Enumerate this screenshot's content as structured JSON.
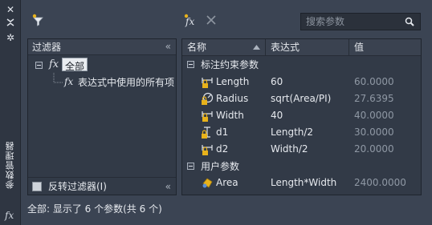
{
  "strip": {
    "title": "参数管理器",
    "fx_label": "fx"
  },
  "toolbar": {
    "filter_icon": "funnel-star-icon",
    "new_param_icon": "fx-star-icon",
    "delete_icon": "close-icon",
    "search_placeholder": "搜索参数"
  },
  "filter": {
    "title": "过滤器",
    "tree": [
      {
        "label": "全部",
        "selected": true
      },
      {
        "label": "表达式中使用的所有项",
        "selected": false
      }
    ],
    "invert_label": "反转过滤器(I)",
    "invert_checked": false
  },
  "table": {
    "columns": [
      "名称",
      "表达式",
      "值"
    ],
    "groups": [
      {
        "label": "标注约束参数",
        "rows": [
          {
            "icon": "linear-dim-icon",
            "name": "Length",
            "expression": "60",
            "value": "60.0000"
          },
          {
            "icon": "radius-dim-icon",
            "name": "Radius",
            "expression": "sqrt(Area/PI)",
            "value": "27.6395"
          },
          {
            "icon": "linear-dim-icon",
            "name": "Width",
            "expression": "40",
            "value": "40.0000"
          },
          {
            "icon": "vertical-dim-icon",
            "name": "d1",
            "expression": "Length/2",
            "value": "30.0000"
          },
          {
            "icon": "linear-dim-icon",
            "name": "d2",
            "expression": "Width/2",
            "value": "20.0000"
          }
        ]
      },
      {
        "label": "用户参数",
        "rows": [
          {
            "icon": "user-param-icon",
            "name": "Area",
            "expression": "Length*Width",
            "value": "2400.0000"
          }
        ]
      }
    ]
  },
  "status": "全部: 显示了 6 个参数(共 6 个)",
  "colors": {
    "panel_bg": "#323a47",
    "window_bg": "#3b4453",
    "lock_yellow": "#e8b21b",
    "value_grey": "#8f98a4"
  }
}
